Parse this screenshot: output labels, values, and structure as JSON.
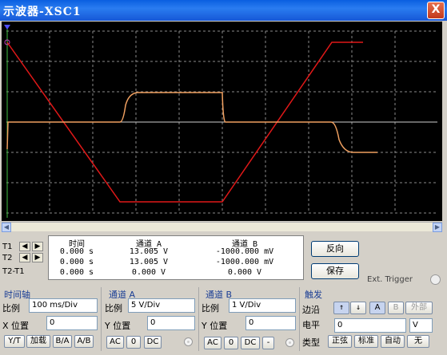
{
  "window": {
    "title": "示波器-XSC1",
    "close_label": "X"
  },
  "readout": {
    "headers": [
      "时间",
      "通道_A",
      "通道_B"
    ],
    "rows": [
      {
        "label": "T1",
        "time": "0.000 s",
        "a": "13.005 V",
        "b": "-1000.000 mV"
      },
      {
        "label": "T2",
        "time": "0.000 s",
        "a": "13.005 V",
        "b": "-1000.000 mV"
      },
      {
        "label": "T2-T1",
        "time": "0.000 s",
        "a": "0.000 V",
        "b": "0.000 V"
      }
    ]
  },
  "buttons": {
    "reverse": "反向",
    "save": "保存",
    "ext_trigger": "Ext. Trigger"
  },
  "timebase": {
    "title": "时间轴",
    "scale_label": "比例",
    "scale": "100 ms/Div",
    "xpos_label": "X 位置",
    "xpos": "0",
    "modes": [
      "Y/T",
      "加载",
      "B/A",
      "A/B"
    ]
  },
  "channel_a": {
    "title": "通道 A",
    "scale_label": "比例",
    "scale": "5  V/Div",
    "ypos_label": "Y 位置",
    "ypos": "0",
    "coupling": [
      "AC",
      "0",
      "DC"
    ]
  },
  "channel_b": {
    "title": "通道 B",
    "scale_label": "比例",
    "scale": "1  V/Div",
    "ypos_label": "Y 位置",
    "ypos": "0",
    "coupling": [
      "AC",
      "0",
      "DC",
      "-"
    ]
  },
  "trigger": {
    "title": "触发",
    "edge_label": "边沿",
    "level_label": "电平",
    "level": "0",
    "level_unit": "V",
    "type_label": "类型",
    "sources": [
      "A",
      "B",
      "外部"
    ],
    "types": [
      "正弦",
      "标准",
      "自动",
      "无"
    ]
  },
  "colors": {
    "screen_bg": "#000000",
    "trace_a": "#e01818",
    "trace_b": "#f0a060",
    "grid": "#808080"
  }
}
